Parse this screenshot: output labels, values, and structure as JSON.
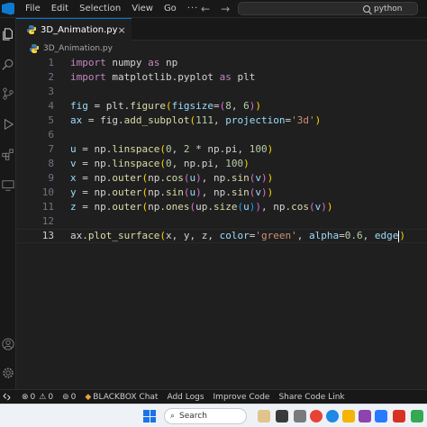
{
  "menubar": {
    "items": [
      "File",
      "Edit",
      "Selection",
      "View",
      "Go"
    ],
    "more": "···",
    "back_arrow": "←",
    "forward_arrow": "→",
    "search_text": "python"
  },
  "activity_icons": [
    "files-icon",
    "search-icon",
    "source-control-icon",
    "run-debug-icon",
    "extensions-icon",
    "remote-explorer-icon",
    "account-icon",
    "settings-gear-icon"
  ],
  "tab": {
    "label": "3D_Animation.py",
    "close": "×"
  },
  "breadcrumb": {
    "file": "3D_Animation.py"
  },
  "editor": {
    "active_line": 13,
    "lines": [
      {
        "n": "1",
        "tokens": [
          [
            "kw",
            "import"
          ],
          [
            "plain",
            " numpy "
          ],
          [
            "kw",
            "as"
          ],
          [
            "plain",
            " np"
          ]
        ]
      },
      {
        "n": "2",
        "tokens": [
          [
            "kw",
            "import"
          ],
          [
            "plain",
            " matplotlib.pyplot "
          ],
          [
            "kw",
            "as"
          ],
          [
            "plain",
            " plt"
          ]
        ]
      },
      {
        "n": "3",
        "tokens": []
      },
      {
        "n": "4",
        "tokens": [
          [
            "var",
            "fig"
          ],
          [
            "plain",
            " = plt."
          ],
          [
            "fn",
            "figure"
          ],
          [
            "br1",
            "("
          ],
          [
            "var",
            "figsize"
          ],
          [
            "plain",
            "="
          ],
          [
            "br2",
            "("
          ],
          [
            "num",
            "8"
          ],
          [
            "plain",
            ", "
          ],
          [
            "num",
            "6"
          ],
          [
            "br2",
            ")"
          ],
          [
            "br1",
            ")"
          ]
        ]
      },
      {
        "n": "5",
        "tokens": [
          [
            "var",
            "ax"
          ],
          [
            "plain",
            " = fig."
          ],
          [
            "fn",
            "add_subplot"
          ],
          [
            "br1",
            "("
          ],
          [
            "num",
            "111"
          ],
          [
            "plain",
            ", "
          ],
          [
            "var",
            "projection"
          ],
          [
            "plain",
            "="
          ],
          [
            "str",
            "'3d'"
          ],
          [
            "br1",
            ")"
          ]
        ]
      },
      {
        "n": "6",
        "tokens": []
      },
      {
        "n": "7",
        "tokens": [
          [
            "var",
            "u"
          ],
          [
            "plain",
            " = np."
          ],
          [
            "fn",
            "linspace"
          ],
          [
            "br1",
            "("
          ],
          [
            "num",
            "0"
          ],
          [
            "plain",
            ", "
          ],
          [
            "num",
            "2"
          ],
          [
            "plain",
            " * np.pi, "
          ],
          [
            "num",
            "100"
          ],
          [
            "br1",
            ")"
          ]
        ]
      },
      {
        "n": "8",
        "tokens": [
          [
            "var",
            "v"
          ],
          [
            "plain",
            " = np."
          ],
          [
            "fn",
            "linspace"
          ],
          [
            "br1",
            "("
          ],
          [
            "num",
            "0"
          ],
          [
            "plain",
            ", np.pi, "
          ],
          [
            "num",
            "100"
          ],
          [
            "br1",
            ")"
          ]
        ]
      },
      {
        "n": "9",
        "tokens": [
          [
            "var",
            "x"
          ],
          [
            "plain",
            " = np."
          ],
          [
            "fn",
            "outer"
          ],
          [
            "br1",
            "("
          ],
          [
            "plain",
            "np."
          ],
          [
            "fn",
            "cos"
          ],
          [
            "br2",
            "("
          ],
          [
            "var",
            "u"
          ],
          [
            "br2",
            ")"
          ],
          [
            "plain",
            ", np."
          ],
          [
            "fn",
            "sin"
          ],
          [
            "br2",
            "("
          ],
          [
            "var",
            "v"
          ],
          [
            "br2",
            ")"
          ],
          [
            "br1",
            ")"
          ]
        ]
      },
      {
        "n": "10",
        "tokens": [
          [
            "var",
            "y"
          ],
          [
            "plain",
            " = np."
          ],
          [
            "fn",
            "outer"
          ],
          [
            "br1",
            "("
          ],
          [
            "plain",
            "np."
          ],
          [
            "fn",
            "sin"
          ],
          [
            "br2",
            "("
          ],
          [
            "var",
            "u"
          ],
          [
            "br2",
            ")"
          ],
          [
            "plain",
            ", np."
          ],
          [
            "fn",
            "sin"
          ],
          [
            "br2",
            "("
          ],
          [
            "var",
            "v"
          ],
          [
            "br2",
            ")"
          ],
          [
            "br1",
            ")"
          ]
        ]
      },
      {
        "n": "11",
        "tokens": [
          [
            "var",
            "z"
          ],
          [
            "plain",
            " = np."
          ],
          [
            "fn",
            "outer"
          ],
          [
            "br1",
            "("
          ],
          [
            "plain",
            "np."
          ],
          [
            "fn",
            "ones"
          ],
          [
            "br2",
            "("
          ],
          [
            "plain",
            "up."
          ],
          [
            "fn",
            "size"
          ],
          [
            "br3",
            "("
          ],
          [
            "var",
            "u"
          ],
          [
            "br3",
            ")"
          ],
          [
            "br2",
            ")"
          ],
          [
            "plain",
            ", np."
          ],
          [
            "fn",
            "cos"
          ],
          [
            "br2",
            "("
          ],
          [
            "var",
            "v"
          ],
          [
            "br2",
            ")"
          ],
          [
            "br1",
            ")"
          ]
        ]
      },
      {
        "n": "12",
        "tokens": []
      },
      {
        "n": "13",
        "tokens": [
          [
            "plain",
            "ax."
          ],
          [
            "fn",
            "plot_surface"
          ],
          [
            "br1",
            "("
          ],
          [
            "plain",
            "x, y, z, "
          ],
          [
            "var",
            "color"
          ],
          [
            "plain",
            "="
          ],
          [
            "str",
            "'green'"
          ],
          [
            "plain",
            ", "
          ],
          [
            "var",
            "alpha"
          ],
          [
            "plain",
            "="
          ],
          [
            "num",
            "0.6"
          ],
          [
            "plain",
            ", "
          ],
          [
            "var",
            "edge"
          ],
          [
            "cursor",
            ""
          ],
          [
            "br1",
            ")"
          ]
        ]
      }
    ]
  },
  "statusbar": {
    "errors": "0",
    "warnings": "0",
    "ports": "0",
    "items": [
      "BLACKBOX Chat",
      "Add Logs",
      "Improve Code",
      "Share Code Link"
    ]
  },
  "taskbar": {
    "search_label": "Search"
  },
  "colors": {
    "accent": "#0078d4",
    "editor_bg": "#1f1f1f",
    "chrome_bg": "#181818",
    "taskbar_bg": "#eef1f6"
  }
}
